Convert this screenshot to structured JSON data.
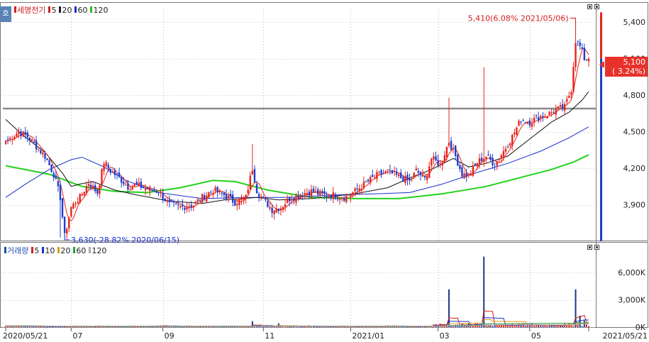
{
  "toolbar_chip": "호",
  "price_panel": {
    "legend": [
      {
        "label": "세명전기",
        "color": "#d21f1f"
      },
      {
        "label": "5",
        "color": "#d21f1f"
      },
      {
        "label": "20",
        "color": "#222222"
      },
      {
        "label": "60",
        "color": "#1a2fd0"
      },
      {
        "label": "120",
        "color": "#22c41b"
      }
    ],
    "y_ticks": [
      "5,400",
      "5,100",
      "4,800",
      "4,500",
      "4,200",
      "3,900"
    ],
    "current_price": "5,100",
    "current_change": "( 3.24%)",
    "max_annotation": "5,410(6.08% 2021/05/06)",
    "min_annotation": "3,630(-28.82% 2020/06/15)"
  },
  "volume_panel": {
    "legend": [
      {
        "label": "거래량",
        "color": "#1f4fb0"
      },
      {
        "label": "5",
        "color": "#d21f1f"
      },
      {
        "label": "10",
        "color": "#1a2fd0"
      },
      {
        "label": "20",
        "color": "#e09a14"
      },
      {
        "label": "60",
        "color": "#22a03b"
      },
      {
        "label": "120",
        "color": "#aaaaaa"
      }
    ],
    "y_ticks": [
      "6,000K",
      "3,000K",
      "0K"
    ]
  },
  "x_ticks": [
    "2020/05/21",
    "07",
    "09",
    "11",
    "2021/01",
    "03",
    "05",
    "2021/05/21"
  ],
  "colors": {
    "up": "#e8231c",
    "down": "#1f3fc8",
    "ma5": "#e8231c",
    "ma20": "#111111",
    "ma60": "#1a2fd0",
    "ma120": "#22d21b",
    "hline": "#8a8a8a"
  },
  "chart_data": [
    {
      "type": "candlestick",
      "title": "세명전기",
      "x_range": [
        "2020/05/21",
        "2021/05/21"
      ],
      "ylim": [
        3600,
        5500
      ],
      "y_ticks": [
        5400,
        5100,
        4800,
        4500,
        4200,
        3900
      ],
      "horizontal_line": 4690,
      "last_close": 5100,
      "last_change_pct": 3.24,
      "max": {
        "value": 5410,
        "change_pct": 6.08,
        "date": "2021/05/06"
      },
      "min": {
        "value": 3630,
        "change_pct": -28.82,
        "date": "2020/06/15"
      },
      "moving_averages": [
        5,
        20,
        60,
        120
      ],
      "close_path": [
        [
          0,
          4420
        ],
        [
          6,
          4500
        ],
        [
          10,
          4460
        ],
        [
          14,
          4380
        ],
        [
          18,
          4300
        ],
        [
          22,
          4150
        ],
        [
          25,
          3960
        ],
        [
          27,
          3640
        ],
        [
          30,
          3880
        ],
        [
          34,
          3960
        ],
        [
          38,
          4080
        ],
        [
          42,
          4000
        ],
        [
          45,
          4250
        ],
        [
          48,
          4180
        ],
        [
          52,
          4120
        ],
        [
          56,
          4050
        ],
        [
          60,
          4060
        ],
        [
          65,
          4030
        ],
        [
          70,
          4010
        ],
        [
          75,
          3900
        ],
        [
          80,
          3880
        ],
        [
          86,
          3900
        ],
        [
          90,
          3960
        ],
        [
          95,
          4020
        ],
        [
          100,
          3980
        ],
        [
          105,
          3920
        ],
        [
          110,
          3960
        ],
        [
          113,
          4200
        ],
        [
          115,
          4020
        ],
        [
          118,
          3940
        ],
        [
          122,
          3860
        ],
        [
          126,
          3880
        ],
        [
          130,
          3950
        ],
        [
          135,
          3990
        ],
        [
          140,
          4010
        ],
        [
          145,
          3980
        ],
        [
          150,
          3980
        ],
        [
          155,
          3960
        ],
        [
          160,
          4010
        ],
        [
          165,
          4080
        ],
        [
          170,
          4140
        ],
        [
          175,
          4170
        ],
        [
          180,
          4130
        ],
        [
          185,
          4090
        ],
        [
          188,
          4180
        ],
        [
          192,
          4110
        ],
        [
          195,
          4280
        ],
        [
          199,
          4230
        ],
        [
          203,
          4420
        ],
        [
          206,
          4300
        ],
        [
          209,
          4150
        ],
        [
          212,
          4140
        ],
        [
          216,
          4250
        ],
        [
          220,
          4300
        ],
        [
          224,
          4230
        ],
        [
          228,
          4340
        ],
        [
          232,
          4460
        ],
        [
          236,
          4600
        ],
        [
          240,
          4580
        ],
        [
          244,
          4620
        ],
        [
          248,
          4640
        ],
        [
          252,
          4680
        ],
        [
          256,
          4700
        ],
        [
          259,
          4850
        ],
        [
          261,
          5250
        ],
        [
          263,
          5200
        ],
        [
          265,
          5100
        ],
        [
          267,
          5100
        ]
      ],
      "moving_average_paths": {
        "ma20": [
          [
            0,
            4600
          ],
          [
            8,
            4470
          ],
          [
            18,
            4330
          ],
          [
            26,
            4160
          ],
          [
            30,
            4050
          ],
          [
            34,
            4070
          ],
          [
            40,
            4090
          ],
          [
            50,
            4020
          ],
          [
            60,
            3980
          ],
          [
            75,
            3930
          ],
          [
            90,
            3910
          ],
          [
            100,
            3940
          ],
          [
            115,
            3960
          ],
          [
            125,
            3940
          ],
          [
            140,
            3950
          ],
          [
            160,
            3990
          ],
          [
            175,
            4040
          ],
          [
            185,
            4120
          ],
          [
            195,
            4190
          ],
          [
            205,
            4280
          ],
          [
            212,
            4210
          ],
          [
            220,
            4240
          ],
          [
            230,
            4300
          ],
          [
            240,
            4440
          ],
          [
            250,
            4580
          ],
          [
            258,
            4660
          ],
          [
            264,
            4760
          ],
          [
            267,
            4830
          ]
        ],
        "ma60": [
          [
            0,
            3960
          ],
          [
            10,
            4080
          ],
          [
            20,
            4190
          ],
          [
            30,
            4270
          ],
          [
            35,
            4290
          ],
          [
            45,
            4210
          ],
          [
            55,
            4100
          ],
          [
            70,
            4000
          ],
          [
            90,
            3950
          ],
          [
            110,
            3960
          ],
          [
            130,
            3960
          ],
          [
            150,
            3980
          ],
          [
            170,
            3990
          ],
          [
            185,
            4000
          ],
          [
            200,
            4070
          ],
          [
            215,
            4160
          ],
          [
            230,
            4240
          ],
          [
            245,
            4340
          ],
          [
            258,
            4450
          ],
          [
            267,
            4540
          ]
        ],
        "ma120": [
          [
            0,
            4220
          ],
          [
            20,
            4150
          ],
          [
            35,
            4050
          ],
          [
            50,
            4010
          ],
          [
            65,
            4000
          ],
          [
            80,
            4040
          ],
          [
            95,
            4100
          ],
          [
            105,
            4090
          ],
          [
            120,
            4020
          ],
          [
            140,
            3960
          ],
          [
            160,
            3950
          ],
          [
            180,
            3950
          ],
          [
            200,
            3990
          ],
          [
            220,
            4050
          ],
          [
            235,
            4120
          ],
          [
            250,
            4190
          ],
          [
            260,
            4250
          ],
          [
            267,
            4310
          ]
        ]
      }
    },
    {
      "type": "bar",
      "title": "거래량",
      "unit": "K shares",
      "x_range": [
        "2020/05/21",
        "2021/05/21"
      ],
      "ylim": [
        0,
        8500
      ],
      "y_ticks": [
        6000,
        3000,
        0
      ],
      "moving_averages": [
        5,
        10,
        20,
        60,
        120
      ],
      "base_volume": 110,
      "spikes": [
        {
          "session": 113,
          "value": 650
        },
        {
          "session": 125,
          "value": 420
        },
        {
          "session": 203,
          "value": 4150
        },
        {
          "session": 209,
          "value": 430
        },
        {
          "session": 212,
          "value": 390
        },
        {
          "session": 219,
          "value": 7750
        },
        {
          "session": 261,
          "value": 4150
        },
        {
          "session": 263,
          "value": 1250
        },
        {
          "session": 265,
          "value": 720
        }
      ]
    }
  ]
}
